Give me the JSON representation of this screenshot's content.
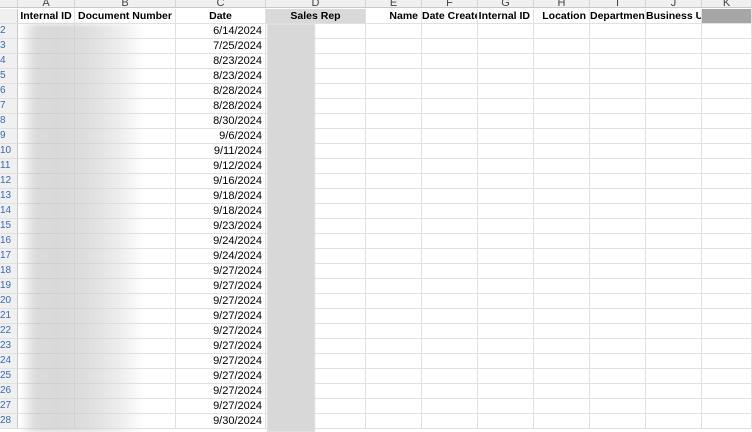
{
  "column_letters": [
    "A",
    "B",
    "C",
    "D",
    "E",
    "F",
    "G",
    "H",
    "I",
    "J",
    "K"
  ],
  "headers": {
    "a": "Internal ID",
    "b": "Document Number",
    "c": "Date",
    "d": "Sales Rep",
    "e": "Name",
    "f": "Date Create",
    "g": "Internal ID",
    "h": "Location",
    "i": "Department",
    "j": "Business Un"
  },
  "row_numbers": [
    "2",
    "3",
    "4",
    "5",
    "6",
    "7",
    "8",
    "9",
    "10",
    "11",
    "12",
    "13",
    "14",
    "15",
    "16",
    "17",
    "18",
    "19",
    "20",
    "21",
    "22",
    "23",
    "24",
    "25",
    "26",
    "27",
    "28"
  ],
  "dates": [
    "6/14/2024",
    "7/25/2024",
    "8/23/2024",
    "8/23/2024",
    "8/28/2024",
    "8/28/2024",
    "8/30/2024",
    "9/6/2024",
    "9/11/2024",
    "9/12/2024",
    "9/16/2024",
    "9/18/2024",
    "9/18/2024",
    "9/23/2024",
    "9/24/2024",
    "9/24/2024",
    "9/27/2024",
    "9/27/2024",
    "9/27/2024",
    "9/27/2024",
    "9/27/2024",
    "9/27/2024",
    "9/27/2024",
    "9/27/2024",
    "9/27/2024",
    "9/27/2024",
    "9/30/2024"
  ]
}
